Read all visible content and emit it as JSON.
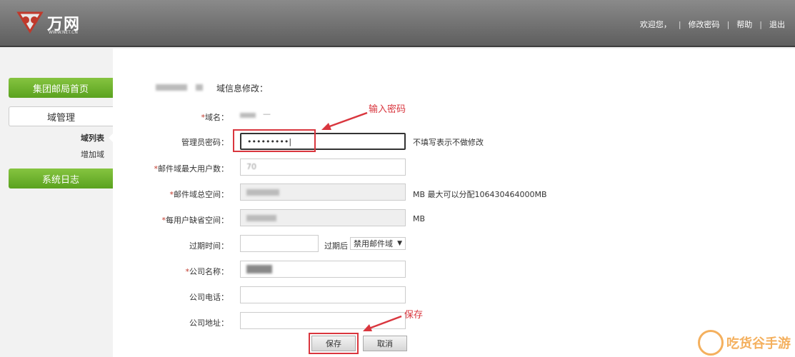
{
  "header": {
    "logo_name": "万网",
    "logo_url": "WWW.NET.CN",
    "nav": [
      "欢迎您，",
      "修改密码",
      "帮助",
      "退出"
    ]
  },
  "sidebar": {
    "home": "集团邮局首页",
    "domain_mgmt": "域管理",
    "domain_list": "域列表",
    "add_domain": "增加域",
    "system_log": "系统日志"
  },
  "form": {
    "title": "域信息修改：",
    "domain_label": "域名：",
    "admin_pwd_label": "管理员密码：",
    "admin_pwd_value": "•••••••••",
    "admin_pwd_note": "不填写表示不做修改",
    "max_users_label": "邮件域最大用户数：",
    "max_users_value": "70",
    "total_space_label": "邮件域总空间：",
    "total_space_note": "MB  最大可以分配106430464000MB",
    "per_user_label": "每用户缺省空间：",
    "per_user_note": "MB",
    "expire_label": "过期时间：",
    "expire_after": "过期后",
    "expire_select": "禁用邮件域",
    "company_name_label": "公司名称：",
    "company_phone_label": "公司电话：",
    "company_addr_label": "公司地址：",
    "save": "保存",
    "cancel": "取消"
  },
  "annotations": {
    "input_password": "输入密码",
    "save": "保存"
  },
  "watermark": "吃货谷手游",
  "colors": {
    "accent_green": "#6ab22e",
    "annotation_red": "#d9363e"
  }
}
